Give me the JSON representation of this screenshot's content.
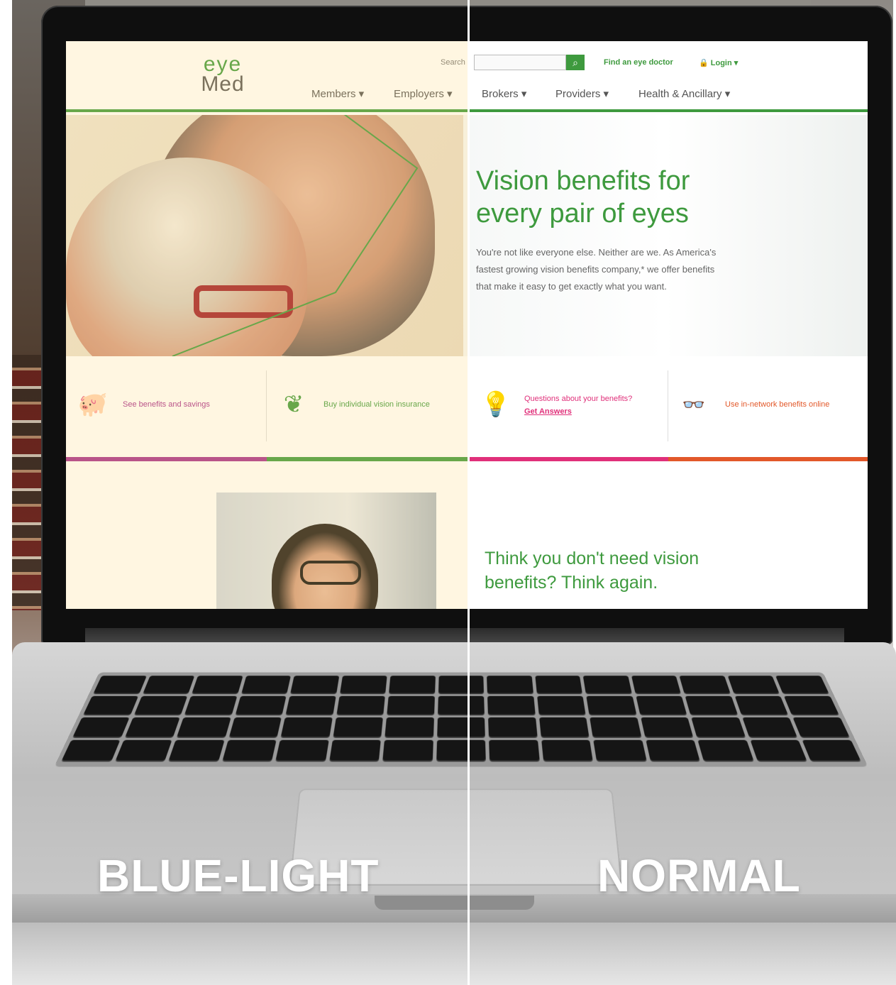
{
  "site": {
    "logo_line1": "eye",
    "logo_line2": "Med",
    "search_label": "Search",
    "search_placeholder": "",
    "find_doctor": "Find an eye doctor",
    "login": "Login ▾",
    "nav": [
      "Members ▾",
      "Employers ▾",
      "Brokers ▾",
      "Providers ▾",
      "Health & Ancillary ▾"
    ]
  },
  "hero": {
    "title_line1": "Vision benefits for",
    "title_line2": "every pair of eyes",
    "text": "You're not like everyone else. Neither are we. As America's fastest growing vision benefits company,* we offer benefits that make it easy to get exactly what you want."
  },
  "features": [
    {
      "label": "See benefits and savings",
      "color": "#a6308f"
    },
    {
      "label": "Buy individual vision insurance",
      "color": "#3e9a3e"
    },
    {
      "label": "Questions about your benefits?",
      "sublabel": "Get Answers",
      "color": "#e0307a"
    },
    {
      "label": "Use in-network benefits online",
      "color": "#e2582a"
    }
  ],
  "lower": {
    "title_line1": "Think you don't need vision",
    "title_line2": "benefits? Think again."
  },
  "captions": {
    "left": "BLUE-LIGHT",
    "right": "NORMAL"
  },
  "colors": {
    "brand_green": "#3e9a3e",
    "magenta": "#a6308f",
    "pink": "#e0307a",
    "orange": "#e2582a"
  }
}
